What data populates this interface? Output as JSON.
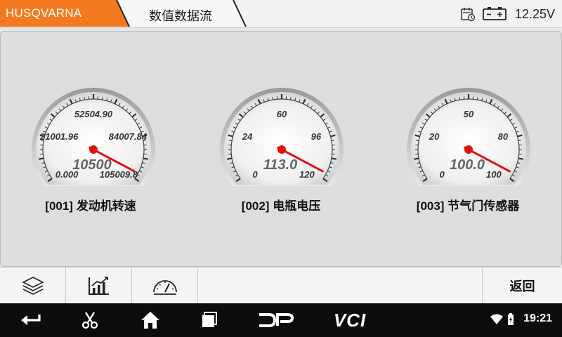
{
  "header": {
    "brand": "HUSQVARNA",
    "title": "数值数据流",
    "voltage": "12.25V",
    "brand_color": "#f47a20"
  },
  "gauges": [
    {
      "label": "[001] 发动机转速",
      "value_text": "10500",
      "value": 10500,
      "min": 0,
      "max": 105009.8,
      "ticks": [
        "0.000",
        "21001.96",
        "52504.90",
        "84007.84",
        "105009.8"
      ]
    },
    {
      "label": "[002] 电瓶电压",
      "value_text": "113.0",
      "value": 113.0,
      "min": 0,
      "max": 120,
      "ticks": [
        "0",
        "24",
        "60",
        "96",
        "120"
      ]
    },
    {
      "label": "[003] 节气门传感器",
      "value_text": "100.0",
      "value": 100.0,
      "min": 0,
      "max": 100,
      "ticks": [
        "0",
        "20",
        "50",
        "80",
        "100"
      ]
    }
  ],
  "toolbar": {
    "buttons": [
      "layers-icon",
      "line-chart-icon",
      "gauge-icon"
    ],
    "back_label": "返回"
  },
  "navbar": {
    "items": [
      "back-arrow-icon",
      "scissors-icon",
      "home-icon",
      "recents-icon",
      "dp-logo",
      "vci-logo"
    ],
    "dp_text": "DP",
    "vci_text": "VCI",
    "time": "19:21"
  }
}
